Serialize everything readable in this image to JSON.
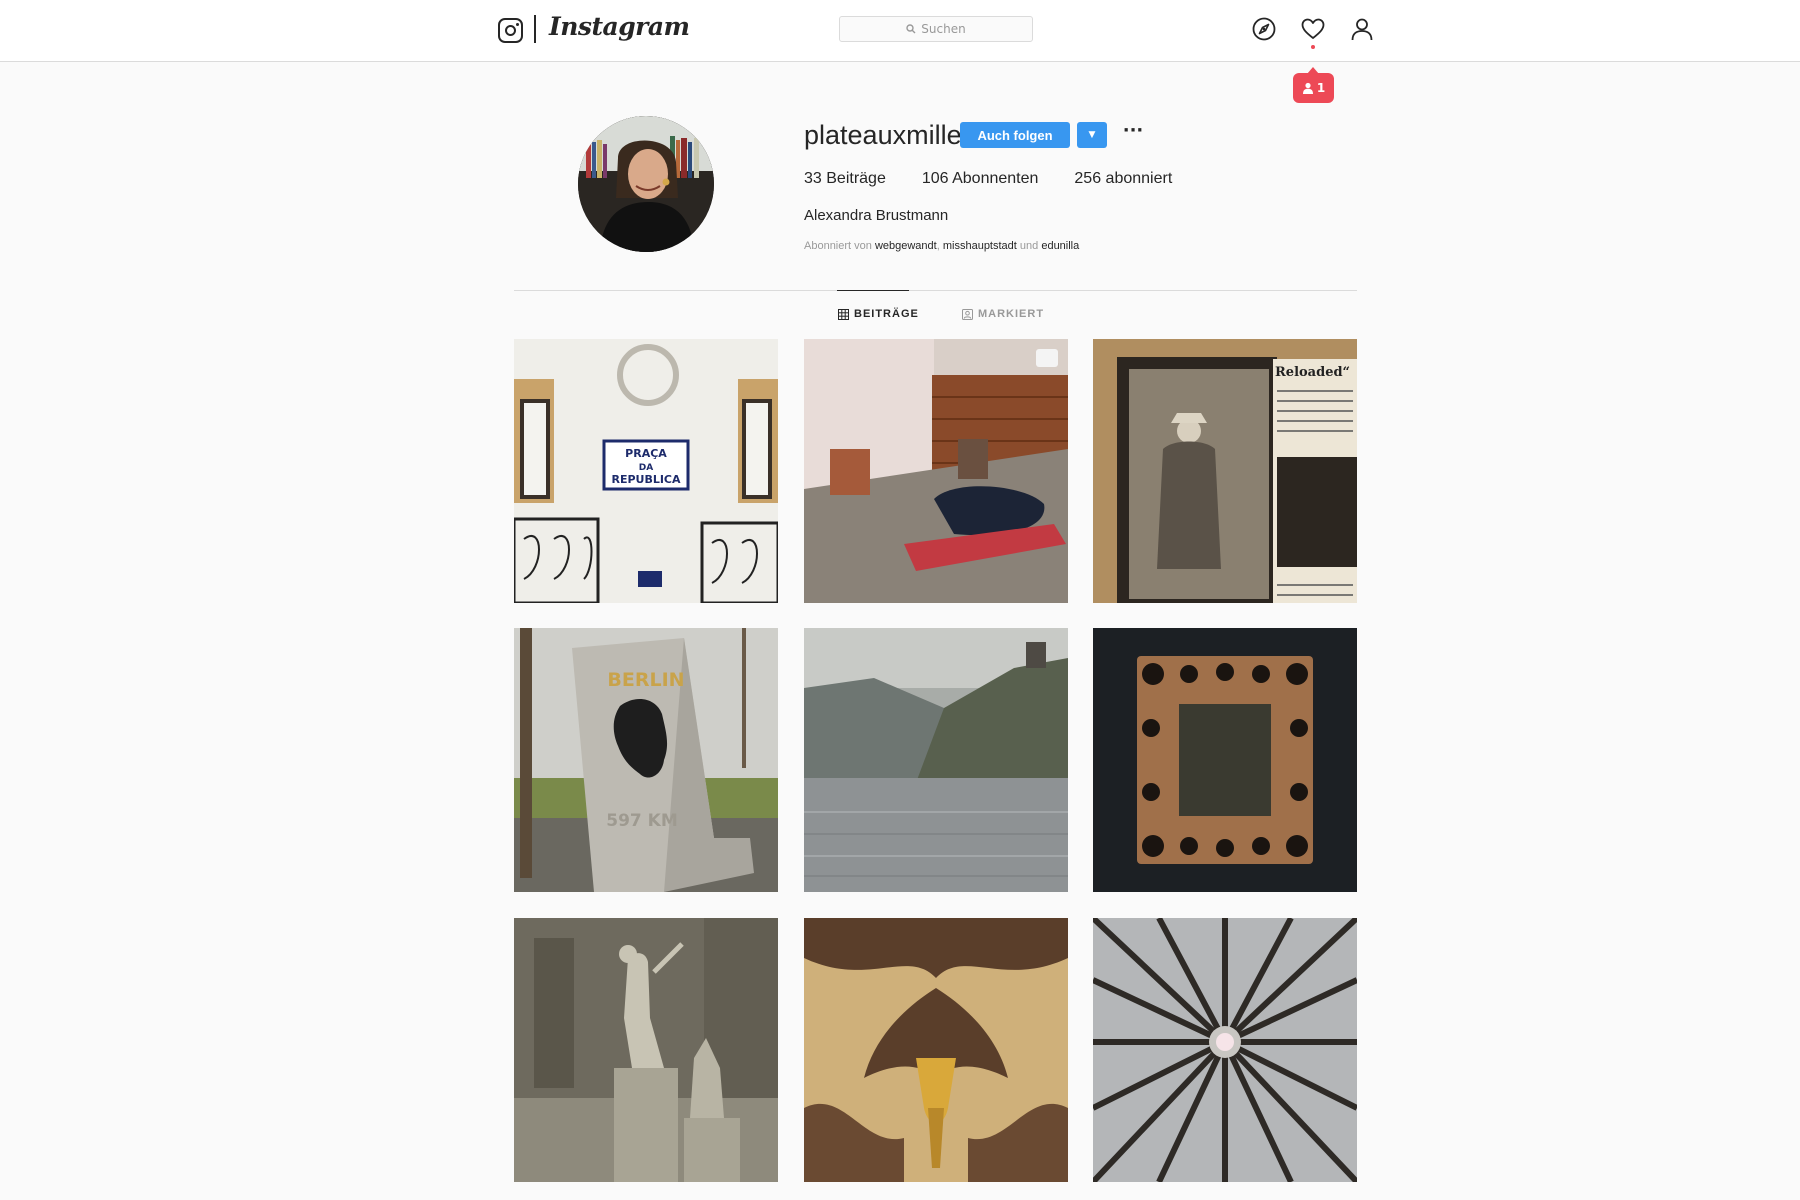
{
  "header": {
    "wordmark": "Instagram",
    "search_placeholder": "Suchen",
    "icons": [
      "instagram-glyph-icon",
      "search-icon",
      "compass-icon",
      "heart-icon",
      "profile-icon"
    ],
    "notification_count": "1",
    "notification_color": "#ed4956"
  },
  "profile": {
    "username": "plateauxmille",
    "follow_label": "Auch folgen",
    "dropdown_glyph": "▼",
    "more_glyph": "···",
    "stats": {
      "posts": "33 Beiträge",
      "followers": "106 Abonnenten",
      "following": "256 abonniert"
    },
    "full_name": "Alexandra Brustmann",
    "followed_by": {
      "prefix": "Abonniert von",
      "user1": "webgewandt",
      "sep": ",",
      "user2": "misshauptstadt",
      "conj": "und",
      "user3": "edunilla"
    },
    "accent_color": "#3897f0"
  },
  "tabs": {
    "posts": "BEITRÄGE",
    "tagged": "MARKIERT"
  },
  "posts": [
    {
      "subject": "Praça da República building facade",
      "sign_line1": "PRAÇA",
      "sign_line2": "DA",
      "sign_line3": "REPUBLICA"
    },
    {
      "subject": "Room with sleeping bag on mat"
    },
    {
      "subject": "Vintage photo of man in coat",
      "caption_word": "Reloaded“"
    },
    {
      "subject": "Berlin distance stone",
      "stone_city": "BERLIN",
      "stone_distance": "597 KM"
    },
    {
      "subject": "Rhine river with castle"
    },
    {
      "subject": "Ornate gold frame on dark wall"
    },
    {
      "subject": "Perseus statue, sepia"
    },
    {
      "subject": "Patterned wallpaper with gold sconce"
    },
    {
      "subject": "Radial patterned ceiling"
    }
  ]
}
